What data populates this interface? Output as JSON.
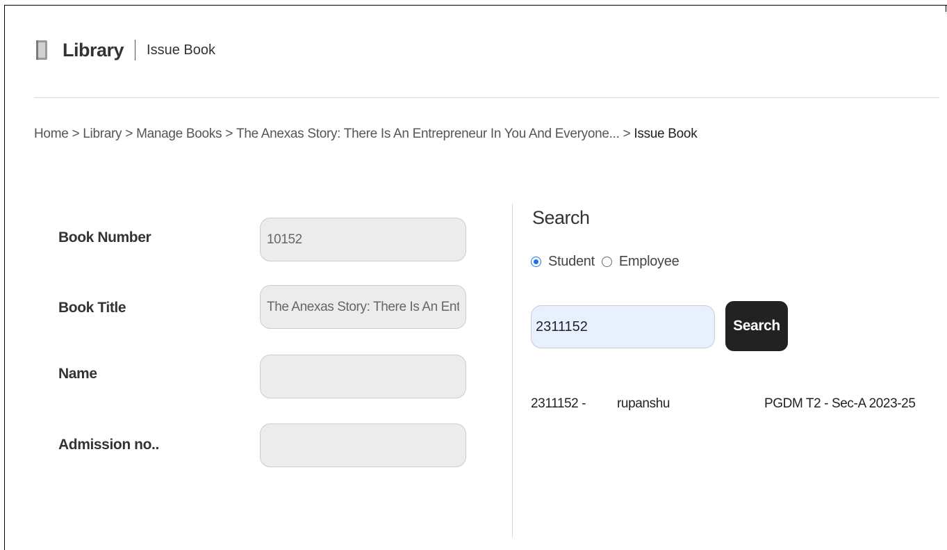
{
  "header": {
    "icon": "book-icon",
    "app_title": "Library",
    "page_subtitle": "Issue Book"
  },
  "breadcrumb": {
    "items": [
      "Home",
      "Library",
      "Manage Books",
      "The Anexas Story: There Is An Entrepreneur In You And Everyone..."
    ],
    "separator": ">",
    "current": "Issue Book"
  },
  "form": {
    "book_number": {
      "label": "Book Number",
      "value": "10152"
    },
    "book_title": {
      "label": "Book Title",
      "value": "The Anexas Story: There Is An Ent"
    },
    "name": {
      "label": "Name",
      "value": ""
    },
    "admission_no": {
      "label": "Admission no..",
      "value": ""
    }
  },
  "search": {
    "heading": "Search",
    "options": [
      {
        "label": "Student",
        "selected": true
      },
      {
        "label": "Employee",
        "selected": false
      }
    ],
    "query": "2311152",
    "button_label": "Search"
  },
  "results": [
    {
      "id": "2311152 -",
      "name": "rupanshu",
      "class": "PGDM T2 - Sec-A 2023-25"
    }
  ],
  "colors": {
    "accent": "#1a73e8",
    "button_bg": "#222222",
    "input_bg": "#ececec",
    "search_input_bg": "#e8f0fe"
  }
}
